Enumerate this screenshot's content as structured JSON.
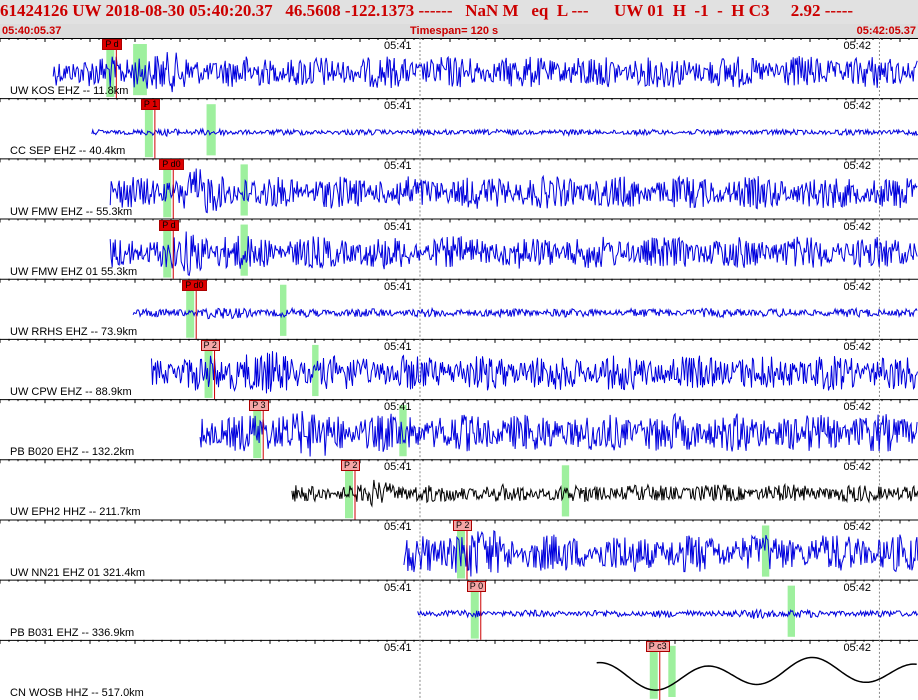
{
  "header": {
    "text": "61424126 UW 2018-08-30 05:40:20.37   46.5608 -122.1373 ------   NaN M   eq  L ---      UW 01  H  -1  -  H C3     2.92 -----"
  },
  "subheader": {
    "start_time": "05:40:05.37",
    "timespan": "Timespan= 120 s",
    "end_time": "05:42:05.37"
  },
  "time_marks": [
    "05:41",
    "05:42"
  ],
  "colors": {
    "trace_blue": "#0000dd",
    "trace_black": "#000000",
    "pick_solid": "#dd0000",
    "pick_light": "#f4a6a6",
    "pick_line": "#cc0000",
    "window_green": "#9ef09e",
    "grid_gray": "#888888"
  },
  "channels": [
    {
      "label": "UW KOS EHZ -- 11.8km",
      "pick": "P d",
      "pick_style": "solid",
      "color": "blue",
      "start": 0.058,
      "amp": 0.55,
      "burst": 0.14,
      "green": [
        0.145,
        0.16
      ]
    },
    {
      "label": "CC SEP EHZ -- 40.4km",
      "pick": "P 1",
      "pick_style": "solid",
      "color": "blue",
      "start": 0.1,
      "amp": 0.1,
      "burst": 0.18,
      "green": [
        0.225,
        0.235
      ]
    },
    {
      "label": "UW FMW EHZ -- 55.3km",
      "pick": "P d0",
      "pick_style": "solid",
      "color": "blue",
      "start": 0.12,
      "amp": 0.55,
      "burst": 0.2,
      "green": [
        0.262,
        0.27
      ]
    },
    {
      "label": "UW FMW EHZ 01 55.3km",
      "pick": "P d",
      "pick_style": "solid",
      "color": "blue",
      "start": 0.12,
      "amp": 0.55,
      "burst": 0.2,
      "green": [
        0.262,
        0.27
      ]
    },
    {
      "label": "UW RRHS EHZ -- 73.9km",
      "pick": "P d0",
      "pick_style": "solid",
      "color": "blue",
      "start": 0.145,
      "amp": 0.15,
      "burst": 0.22,
      "green": [
        0.305,
        0.312
      ]
    },
    {
      "label": "UW CPW EHZ -- 88.9km",
      "pick": "P 2",
      "pick_style": "light",
      "color": "blue",
      "start": 0.165,
      "amp": 0.6,
      "burst": 0.25,
      "green": [
        0.34,
        0.347
      ]
    },
    {
      "label": "PB B020 EHZ -- 132.2km",
      "pick": "P 3",
      "pick_style": "light",
      "color": "blue",
      "start": 0.218,
      "amp": 0.65,
      "burst": 0.3,
      "green": [
        0.435,
        0.443
      ]
    },
    {
      "label": "UW EPH2 HHZ -- 211.7km",
      "pick": "P 2",
      "pick_style": "light",
      "color": "black",
      "start": 0.318,
      "amp": 0.3,
      "burst": 0.4,
      "green": [
        0.612,
        0.62
      ]
    },
    {
      "label": "UW NN21 EHZ 01 321.4km",
      "pick": "P 2",
      "pick_style": "light",
      "color": "blue",
      "start": 0.44,
      "amp": 0.65,
      "burst": 0.49,
      "green": [
        0.83,
        0.838
      ]
    },
    {
      "label": "PB B031 EHZ -- 336.9km",
      "pick": "P 0",
      "pick_style": "light",
      "color": "blue",
      "start": 0.455,
      "amp": 0.12,
      "burst": 0.82,
      "green": [
        0.858,
        0.866
      ]
    },
    {
      "label": "CN WOSB HHZ -- 517.0km",
      "pick": "P c3",
      "pick_style": "light",
      "color": "black",
      "start": 0.65,
      "amp": 0.55,
      "burst": 0.72,
      "green": [
        0.728,
        0.736
      ]
    }
  ]
}
